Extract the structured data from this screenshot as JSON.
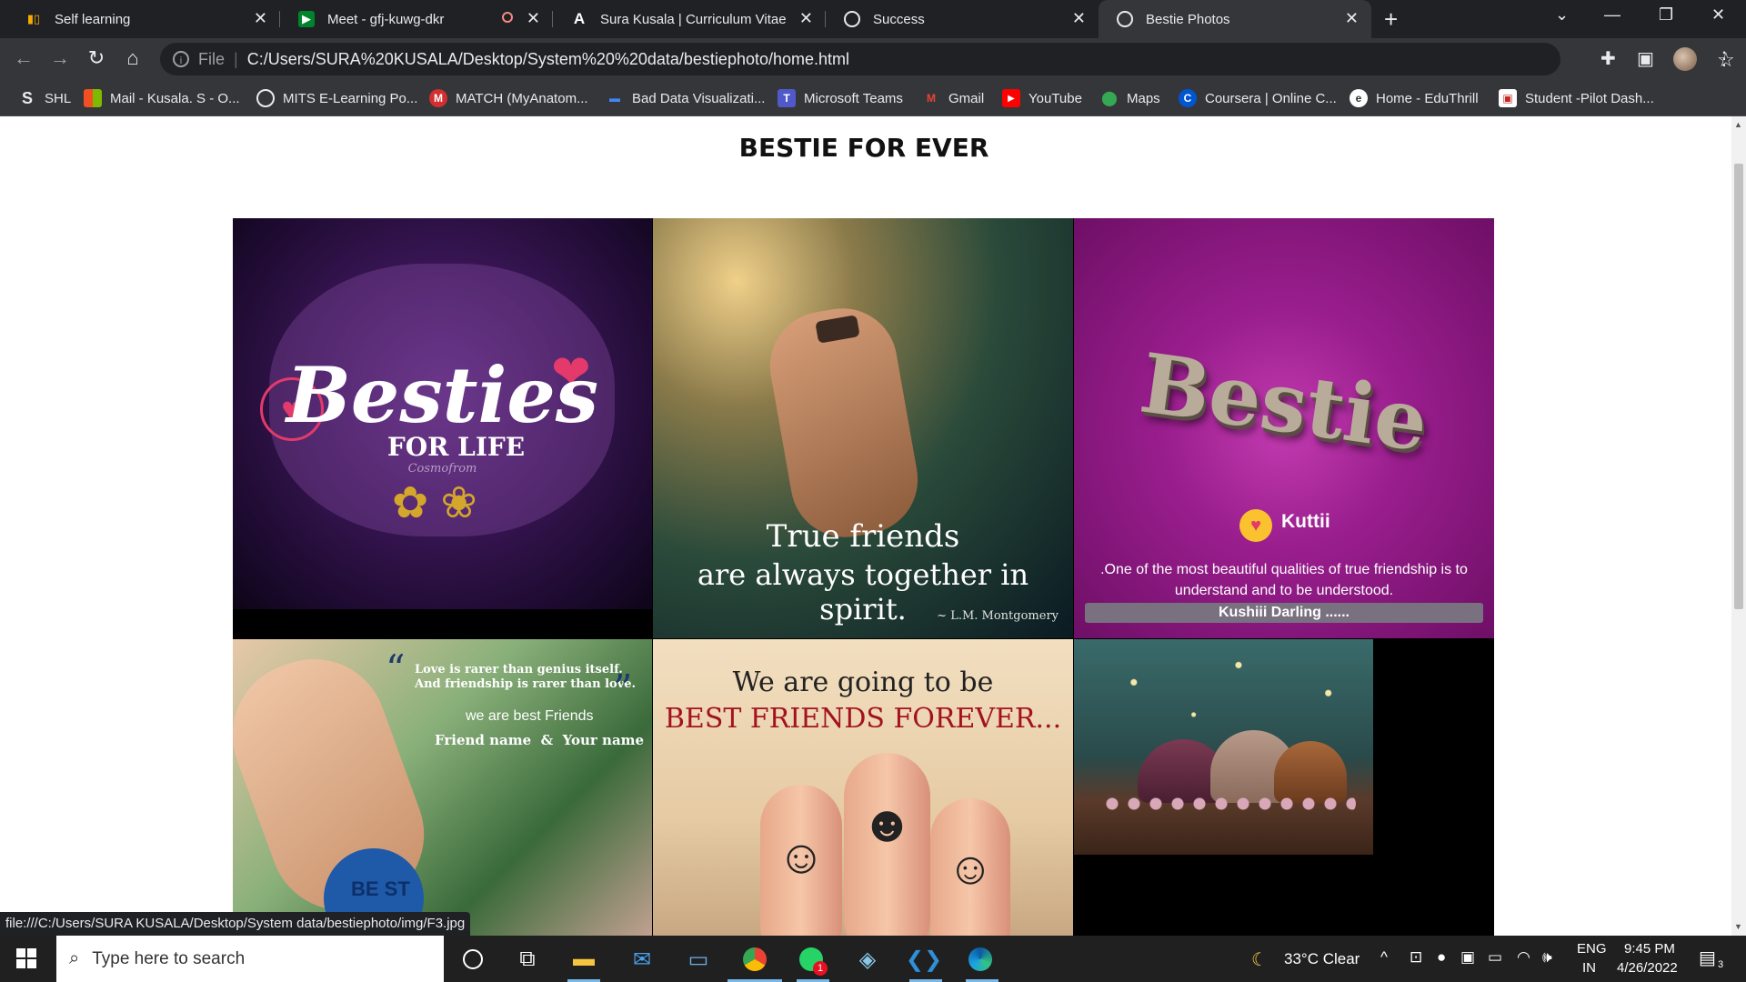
{
  "tabs": [
    {
      "title": "Self learning",
      "icon": "bar-chart-icon"
    },
    {
      "title": "Meet - gfj-kuwg-dkr",
      "icon": "google-meet-icon"
    },
    {
      "title": "Sura Kusala | Curriculum Vitae",
      "icon": "letter-a-icon"
    },
    {
      "title": "Success",
      "icon": "globe-icon"
    },
    {
      "title": "Bestie Photos",
      "icon": "globe-icon"
    }
  ],
  "address": {
    "scheme_label": "File",
    "url": "C:/Users/SURA%20KUSALA/Desktop/System%20%20data/bestiephoto/home.html"
  },
  "bookmarks": [
    {
      "label": "SHL",
      "icon": "letter-s-icon"
    },
    {
      "label": "Mail - Kusala. S - O...",
      "icon": "microsoft-icon"
    },
    {
      "label": "MITS E-Learning Po...",
      "icon": "globe-icon"
    },
    {
      "label": "MATCH (MyAnatom...",
      "icon": "m-icon"
    },
    {
      "label": "Bad Data Visualizati...",
      "icon": "dash-icon"
    },
    {
      "label": "Microsoft Teams",
      "icon": "teams-icon"
    },
    {
      "label": "Gmail",
      "icon": "gmail-icon"
    },
    {
      "label": "YouTube",
      "icon": "youtube-icon"
    },
    {
      "label": "Maps",
      "icon": "maps-icon"
    },
    {
      "label": "Coursera | Online C...",
      "icon": "coursera-icon"
    },
    {
      "label": "Home - EduThrill",
      "icon": "eduthrill-icon"
    },
    {
      "label": "Student -Pilot Dash...",
      "icon": "student-icon"
    }
  ],
  "page": {
    "heading": "BESTIE FOR EVER"
  },
  "photos": {
    "p1": {
      "title": "Besties",
      "subtitle": "FOR LIFE",
      "sig": "Cosmofrom"
    },
    "p2": {
      "line1": "True friends",
      "line2": "are always together in spirit.",
      "author": "~ L.M. Montgomery"
    },
    "p3": {
      "word": "Bestie",
      "name": "Kuttii",
      "quote": ".One of the most beautiful qualities of true friendship is to understand and to be understood.",
      "banner": "Kushiii Darling ......"
    },
    "p4": {
      "quote1": "Love is rarer than genius itself.",
      "quote2": "And friendship is rarer than love.",
      "line": "we are best Friends",
      "names": "Friend name  &  Your name",
      "heart": "BE ST"
    },
    "p5": {
      "line1": "We are going to be",
      "line2": "BEST FRIENDS FOREVER..."
    }
  },
  "status_url": "file:///C:/Users/SURA KUSALA/Desktop/System  data/bestiephoto/img/F3.jpg",
  "taskbar": {
    "search_placeholder": "Type here to search",
    "weather": "33°C  Clear",
    "lang1": "ENG",
    "lang2": "IN",
    "time": "9:45 PM",
    "date": "4/26/2022",
    "notif": "3",
    "whatsapp_badge": "1"
  }
}
